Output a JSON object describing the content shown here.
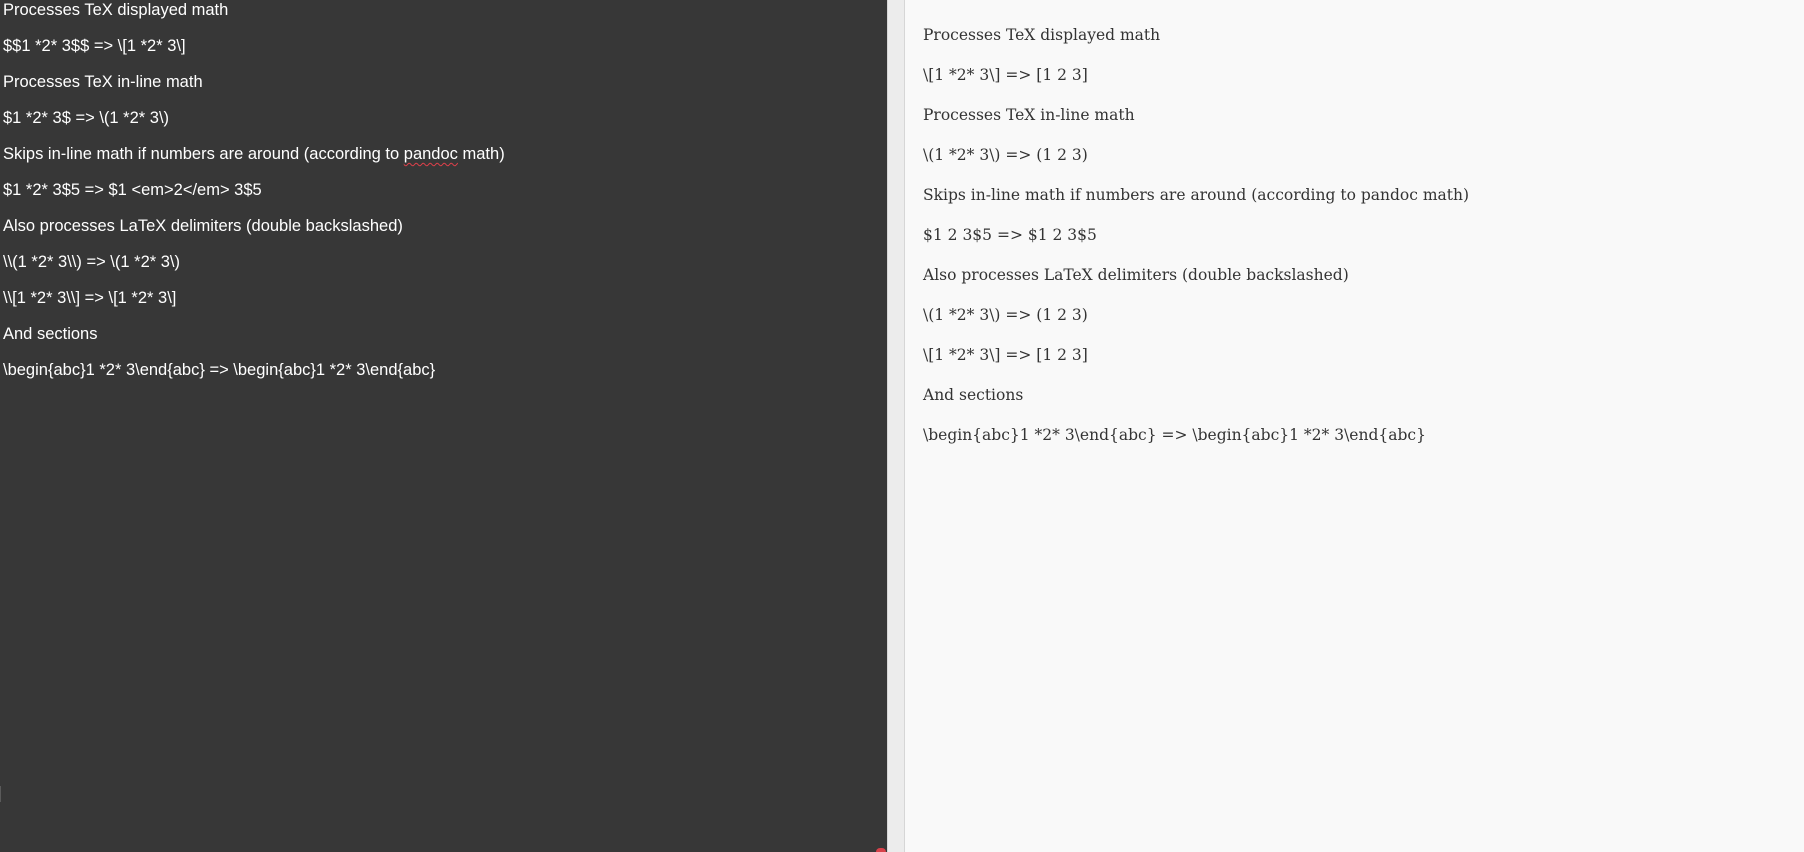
{
  "editor": {
    "lines": [
      "Processes TeX displayed math",
      "$$1 *2* 3$$ => \\[1 *2* 3\\]",
      "Processes TeX in-line math",
      "$1 *2* 3$ => \\(1 *2* 3\\)",
      "Skips in-line math if numbers are around (according to ",
      "$1 *2* 3$5 => $1 <em>2</em> 3$5",
      "Also processes LaTeX delimiters (double backslashed)",
      "\\\\(1 *2* 3\\\\) => \\(1 *2* 3\\)",
      "\\\\[1 *2* 3\\\\] => \\[1 *2* 3\\]",
      "And sections",
      "\\begin{abc}1 *2* 3\\end{abc} => \\begin{abc}1 *2* 3\\end{abc}"
    ],
    "misspelled_word": "pandoc",
    "line5_tail": " math)"
  },
  "preview": {
    "lines": [
      "Processes TeX displayed math",
      "\\[1 *2* 3\\] => [1 2 3]",
      "Processes TeX in-line math",
      "\\(1 *2* 3\\) => (1 2 3)",
      "Skips in-line math if numbers are around (according to pandoc math)",
      "$1 2 3$5 => $1 2 3$5",
      "Also processes LaTeX delimiters (double backslashed)",
      "\\(1 *2* 3\\) => (1 2 3)",
      "\\[1 *2* 3\\] => [1 2 3]",
      "And sections",
      "\\begin{abc}1 *2* 3\\end{abc} => \\begin{abc}1 *2* 3\\end{abc}"
    ]
  },
  "colors": {
    "editor_background": "#373737",
    "editor_text": "#ffffff",
    "preview_background": "#f9f9f9",
    "preview_text": "#333333",
    "spellcheck_underline": "#e0404a"
  }
}
